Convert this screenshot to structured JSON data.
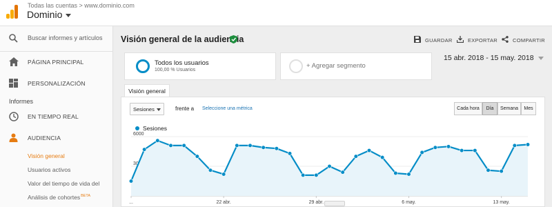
{
  "header": {
    "breadcrumb": "Todas las cuentas > www.dominio.com",
    "account_name": "Dominio"
  },
  "sidebar": {
    "search_placeholder": "Buscar informes y artículos",
    "items": [
      {
        "label": "PÁGINA PRINCIPAL",
        "icon": "home-icon"
      },
      {
        "label": "PERSONALIZACIÓN",
        "icon": "dashboard-icon"
      }
    ],
    "section_title": "Informes",
    "reports": [
      {
        "label": "EN TIEMPO REAL",
        "icon": "clock-icon"
      },
      {
        "label": "AUDIENCIA",
        "icon": "person-icon"
      }
    ],
    "subitems": [
      {
        "label": "Visión general",
        "active": true
      },
      {
        "label": "Usuarios activos"
      },
      {
        "label": "Valor del tiempo de vida del"
      },
      {
        "label": "Análisis de cohortes",
        "badge": "BETA"
      }
    ]
  },
  "main": {
    "title": "Visión general de la audiencia",
    "actions": [
      {
        "label": "GUARDAR",
        "icon": "save-icon"
      },
      {
        "label": "EXPORTAR",
        "icon": "export-icon"
      },
      {
        "label": "COMPARTIR",
        "icon": "share-icon"
      }
    ],
    "segment": {
      "name": "Todos los usuarios",
      "percent": "100,00 % Usuarios",
      "add_label": "+ Agregar segmento"
    },
    "date_range": "15 abr. 2018 - 15 may. 2018",
    "tab": "Visión general",
    "metric_select": "Sesiones",
    "versus": "frente a",
    "pick_metric": "Seleccione una métrica",
    "granularity": [
      {
        "label": "Cada hora"
      },
      {
        "label": "Día",
        "active": true
      },
      {
        "label": "Semana"
      },
      {
        "label": "Mes"
      }
    ]
  },
  "colors": {
    "accent": "#058dc7",
    "active_nav": "#e67c12",
    "fill": "#e8f4fa"
  },
  "chart_data": {
    "type": "area",
    "series": [
      {
        "name": "Sesiones",
        "values": [
          1500,
          4700,
          5600,
          5100,
          5100,
          4000,
          2600,
          2200,
          5100,
          5100,
          4900,
          4800,
          4300,
          2100,
          2100,
          3000,
          2400,
          4000,
          4600,
          3900,
          2300,
          2200,
          4400,
          4900,
          5000,
          4600,
          4600,
          2600,
          2500,
          5100,
          5200
        ]
      }
    ],
    "x_labels": [
      "...",
      "22 abr.",
      "29 abr.",
      "6 may.",
      "13 may."
    ],
    "y_ticks": [
      "6000",
      "3000"
    ],
    "ylim": [
      0,
      6000
    ],
    "grid": true,
    "legend": "top-left"
  }
}
